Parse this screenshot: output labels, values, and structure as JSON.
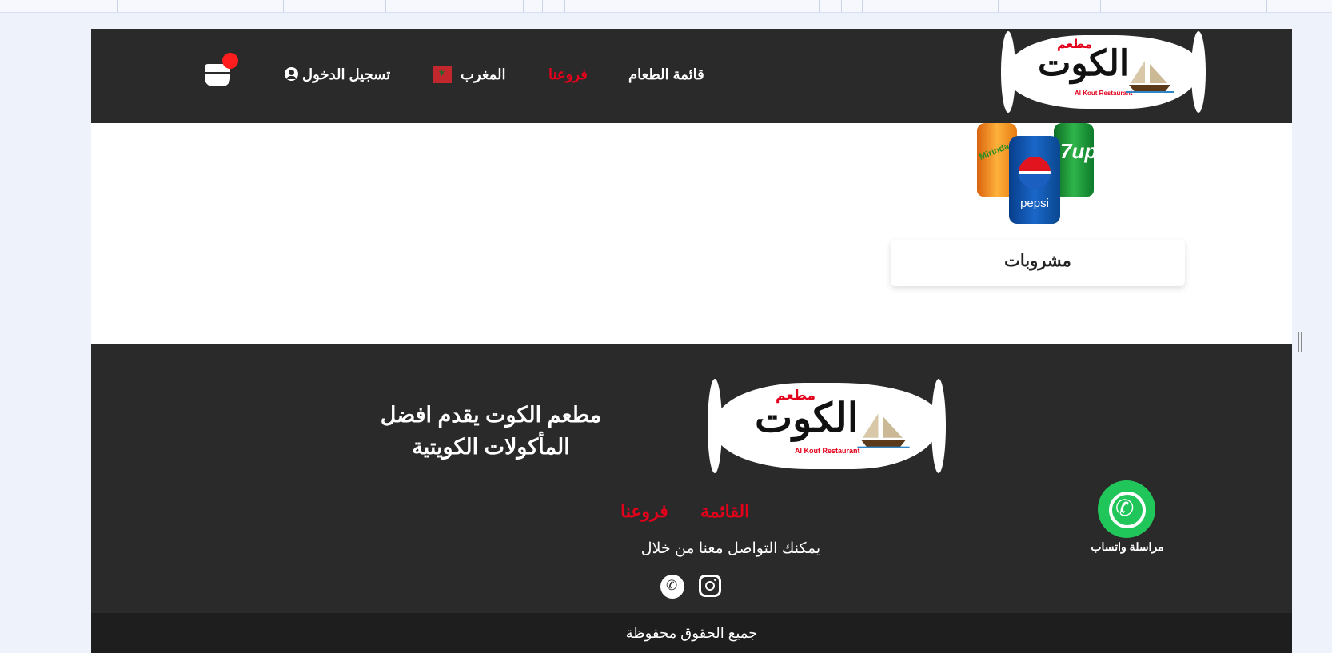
{
  "brand": {
    "logo_ar": "الكوت",
    "logo_small_ar": "مطعم",
    "logo_en": "Al Kout Restaurant"
  },
  "header": {
    "nav": {
      "menu": "قائمة الطعام",
      "branches": "فروعنا",
      "country": "المغرب",
      "login": "تسجيل الدخول"
    },
    "cart_icon": "shopping-bag-icon"
  },
  "category": {
    "title": "مشروبات",
    "image_icon": "soda-cans-image",
    "can_labels": {
      "pepsi": "pepsi",
      "sevenup": "7up",
      "mirinda": "Mirinda"
    }
  },
  "footer": {
    "tagline_line1": "مطعم الكوت يقدم افضل",
    "tagline_line2": "المأكولات الكويتية",
    "links": {
      "menu": "القائمة",
      "branches": "فروعنا"
    },
    "contact_text": "يمكنك التواصل معنا من خلال",
    "social_icons": [
      "instagram-icon",
      "whatsapp-icon"
    ],
    "whatsapp_button_label": "مراسلة واتساب",
    "copyright": "جميع الحقوق محفوظة"
  },
  "colors": {
    "dark_bg": "#2a2a2a",
    "accent_red": "#e3001b",
    "whatsapp_green": "#21c65a"
  }
}
